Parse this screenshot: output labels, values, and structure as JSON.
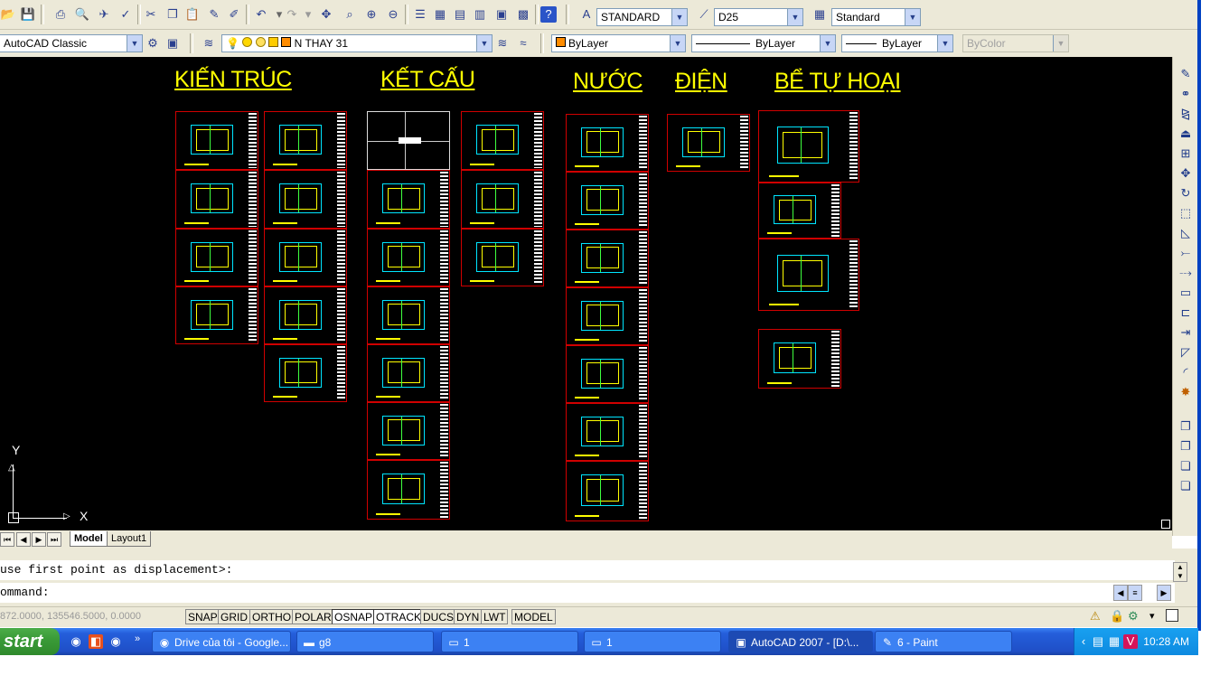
{
  "toolbar": {
    "text_style": "STANDARD",
    "dim_style": "D25",
    "table_style": "Standard",
    "workspace": "AutoCAD Classic",
    "layer": "N THAY 31",
    "color": "ByLayer",
    "linetype": "ByLayer",
    "lineweight": "ByLayer",
    "plotstyle": "ByColor"
  },
  "drawing": {
    "titles": [
      "KIẾN TRÚC",
      "KẾT CẤU",
      "NƯỚC",
      "ĐIỆN",
      "BỂ TỰ HOẠI"
    ],
    "ucs_y": "Y",
    "ucs_x": "X",
    "colors": {
      "frame": "#d00000",
      "title": "#ffff00",
      "background": "#000000"
    }
  },
  "tabs": [
    {
      "label": "Model",
      "active": true
    },
    {
      "label": "Layout1",
      "active": false
    }
  ],
  "command": {
    "history": "use first point as displacement>:",
    "prompt": "ommand:"
  },
  "status": {
    "coords": "872.0000, 135546.5000, 0.0000",
    "buttons": [
      "SNAP",
      "GRID",
      "ORTHO",
      "POLAR",
      "OSNAP",
      "OTRACK",
      "DUCS",
      "DYN",
      "LWT",
      "MODEL"
    ]
  },
  "taskbar": {
    "start": "start",
    "tasks": [
      {
        "label": "Drive của tôi - Google...",
        "icon": "chrome-icon"
      },
      {
        "label": "g8",
        "icon": "folder-icon"
      },
      {
        "label": "1",
        "icon": "monitor-icon"
      },
      {
        "label": "1",
        "icon": "monitor-icon"
      },
      {
        "label": "AutoCAD 2007 - [D:\\...",
        "icon": "autocad-icon"
      },
      {
        "label": "6 - Paint",
        "icon": "paint-icon"
      }
    ],
    "clock": "10:28 AM"
  }
}
